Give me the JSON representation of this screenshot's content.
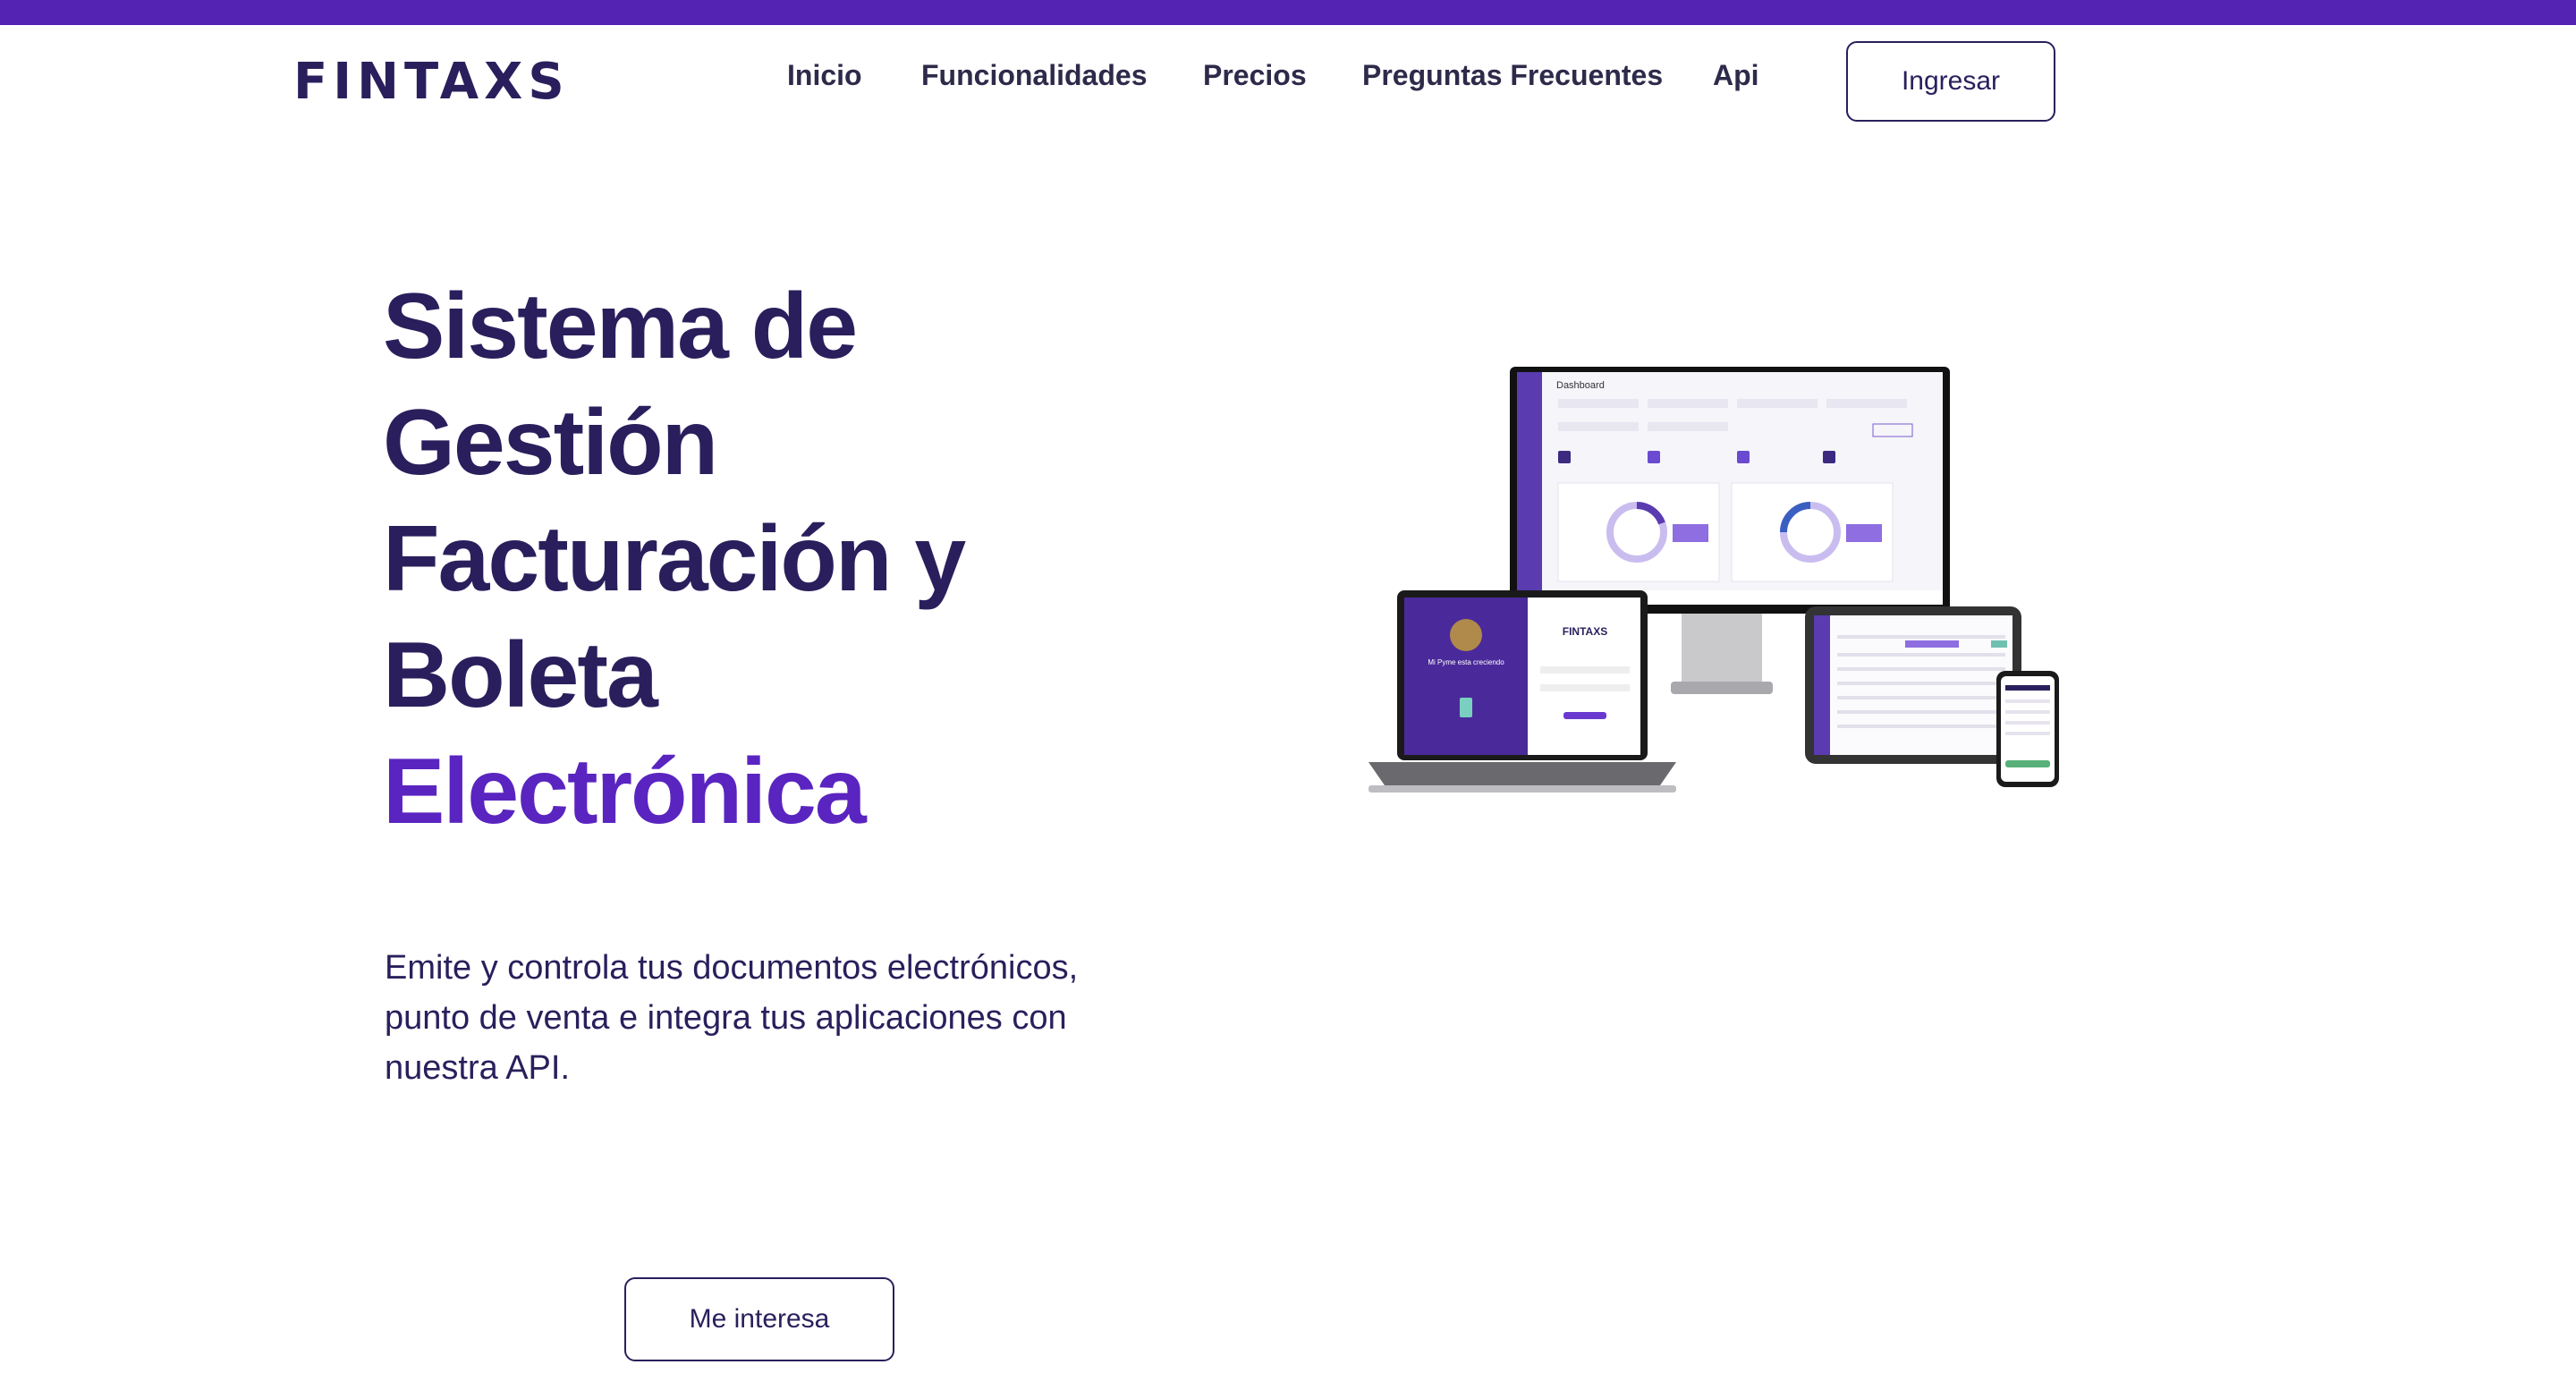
{
  "brand": {
    "logo_text": "FINTAXS"
  },
  "nav": {
    "items": [
      {
        "label": "Inicio"
      },
      {
        "label": "Funcionalidades"
      },
      {
        "label": "Precios"
      },
      {
        "label": "Preguntas Frecuentes"
      },
      {
        "label": "Api"
      }
    ],
    "login_label": "Ingresar"
  },
  "hero": {
    "title_lines": [
      "Sistema de",
      "Gestión",
      "Facturación y",
      "Boleta"
    ],
    "title_accent": "Electrónica",
    "subtitle": "Emite y controla tus documentos electrónicos, punto de venta e integra tus aplicaciones con nuestra API.",
    "cta_label": "Me interesa"
  },
  "mockup": {
    "dashboard_title": "Dashboard",
    "laptop_brand": "FINTAXS",
    "laptop_tagline": "Mi Pyme esta creciendo"
  },
  "colors": {
    "brand_purple": "#5423b4",
    "dark_navy": "#2a1f5c",
    "accent_purple": "#5a24c0"
  }
}
